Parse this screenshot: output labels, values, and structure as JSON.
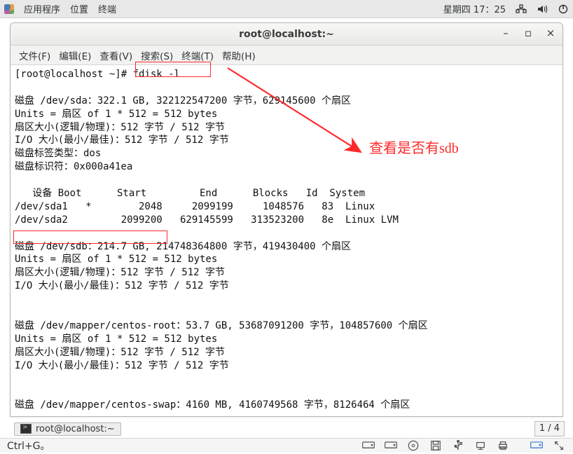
{
  "panel": {
    "apps": "应用程序",
    "places": "位置",
    "terminal": "终端",
    "clock": "星期四 17：25"
  },
  "terminal": {
    "title": "root@localhost:~",
    "menu": {
      "file": "文件(F)",
      "edit": "编辑(E)",
      "view": "查看(V)",
      "search": "搜索(S)",
      "term": "终端(T)",
      "help": "帮助(H)"
    },
    "output": "[root@localhost ~]# fdisk -l\n\n磁盘 /dev/sda：322.1 GB, 322122547200 字节，629145600 个扇区\nUnits = 扇区 of 1 * 512 = 512 bytes\n扇区大小(逻辑/物理)：512 字节 / 512 字节\nI/O 大小(最小/最佳)：512 字节 / 512 字节\n磁盘标签类型：dos\n磁盘标识符：0x000a41ea\n\n   设备 Boot      Start         End      Blocks   Id  System\n/dev/sda1   *        2048     2099199     1048576   83  Linux\n/dev/sda2         2099200   629145599   313523200   8e  Linux LVM\n\n磁盘 /dev/sdb：214.7 GB, 214748364800 字节，419430400 个扇区\nUnits = 扇区 of 1 * 512 = 512 bytes\n扇区大小(逻辑/物理)：512 字节 / 512 字节\nI/O 大小(最小/最佳)：512 字节 / 512 字节\n\n\n磁盘 /dev/mapper/centos-root：53.7 GB, 53687091200 字节，104857600 个扇区\nUnits = 扇区 of 1 * 512 = 512 bytes\n扇区大小(逻辑/物理)：512 字节 / 512 字节\nI/O 大小(最小/最佳)：512 字节 / 512 字节\n\n\n磁盘 /dev/mapper/centos-swap：4160 MB, 4160749568 字节，8126464 个扇区"
  },
  "annotation": {
    "text": "查看是否有sdb"
  },
  "taskbar": {
    "task1": "root@localhost:~",
    "pager": "1 / 4"
  },
  "outer_status": {
    "text": "Ctrl+G。"
  }
}
